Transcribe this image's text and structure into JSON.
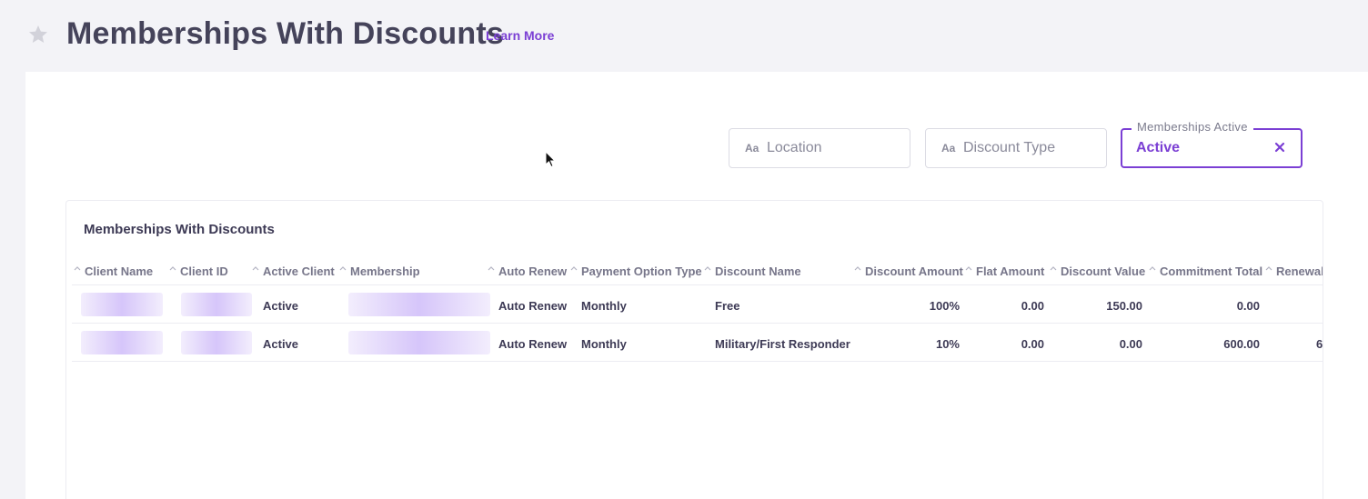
{
  "header": {
    "title": "Memberships With Discounts",
    "learn_more": "Learn More"
  },
  "filters": {
    "location": {
      "icon_text": "Aa",
      "placeholder": "Location"
    },
    "discount_type": {
      "icon_text": "Aa",
      "placeholder": "Discount Type"
    },
    "memberships_active": {
      "legend": "Memberships Active",
      "value": "Active"
    }
  },
  "card": {
    "title": "Memberships With Discounts"
  },
  "table": {
    "columns": [
      "Client Name",
      "Client ID",
      "Active Client",
      "Membership",
      "Auto Renew",
      "Payment Option Type",
      "Discount Name",
      "Discount Amount",
      "Flat Amount",
      "Discount Value",
      "Commitment Total",
      "Renewal"
    ],
    "rows": [
      {
        "active_client": "Active",
        "auto_renew": "Auto Renew",
        "payment_option_type": "Monthly",
        "discount_name": "Free",
        "discount_amount": "100%",
        "flat_amount": "0.00",
        "discount_value": "150.00",
        "commitment_total": "0.00",
        "renewal": ""
      },
      {
        "active_client": "Active",
        "auto_renew": "Auto Renew",
        "payment_option_type": "Monthly",
        "discount_name": "Military/First Responder",
        "discount_amount": "10%",
        "flat_amount": "0.00",
        "discount_value": "0.00",
        "commitment_total": "600.00",
        "renewal": "6"
      }
    ]
  },
  "colors": {
    "accent": "#7b3fd4",
    "background": "#f3f3f7",
    "text": "#3d3a55"
  }
}
